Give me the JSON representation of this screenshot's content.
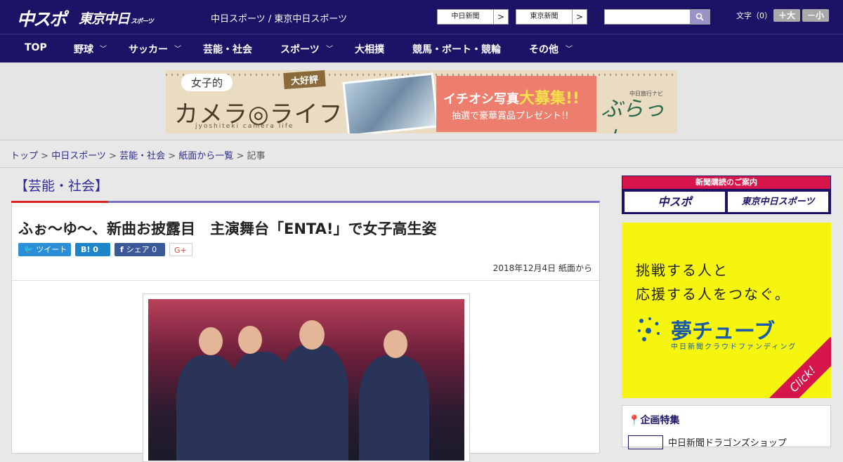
{
  "header": {
    "logo_chuspo": "中スポ",
    "logo_tokyo": "東京中日",
    "logo_tokyo_small": "スポーツ",
    "site_name": "中日スポーツ / 東京中日スポーツ",
    "btn_chunichi": "中日新聞",
    "btn_tokyo": "東京新聞",
    "arrow": ">",
    "search_placeholder": "",
    "font_label": "文字（0）",
    "font_plus": "＋大",
    "font_minus": "－小"
  },
  "nav": [
    {
      "label": "TOP"
    },
    {
      "label": "野球"
    },
    {
      "label": "サッカー"
    },
    {
      "label": "芸能・社会"
    },
    {
      "label": "スポーツ"
    },
    {
      "label": "大相撲"
    },
    {
      "label": "競馬・ボート・競輪"
    },
    {
      "label": "その他"
    }
  ],
  "banner": {
    "bubble": "女子的",
    "tag": "大好評",
    "title": "カメラ◎ライフ",
    "subtitle": "jyoshiteki camera life",
    "line1_a": "イチオシ写真",
    "line1_b": "大募集!!",
    "line2": "抽選で豪華賞品プレゼント!!",
    "brand_small": "中日旅行ナビ",
    "brand": "ぶらっ人"
  },
  "breadcrumb": {
    "items": [
      "トップ",
      "中日スポーツ",
      "芸能・社会",
      "紙面から一覧"
    ],
    "current": "記事",
    "sep": " > "
  },
  "category": "【芸能・社会】",
  "article": {
    "title": "ふぉ～ゆ～、新曲お披露目　主演舞台「ENTA!」で女子高生姿",
    "tweet": "ツイート",
    "hatena": "B! 0",
    "share": "シェア 0",
    "gplus": "G+",
    "date": "2018年12月4日 紙面から"
  },
  "sidebar": {
    "subs_head": "新聞購読のご案内",
    "subs_chuspo": "中スポ",
    "subs_tokyo": "東京中日スポーツ",
    "yume_line1": "挑戦する人と",
    "yume_line2": "応援する人をつなぐ。",
    "yume_logo": "夢チューブ",
    "yume_sub": "中日新聞クラウドファンディング",
    "yume_click": "Click!",
    "kikaku_head": "企画特集",
    "kikaku_item": "中日新聞ドラゴンズショップ"
  },
  "colors": {
    "brand_navy": "#1c1366",
    "accent_red": "#d6154a",
    "link": "#2a2a8a"
  }
}
